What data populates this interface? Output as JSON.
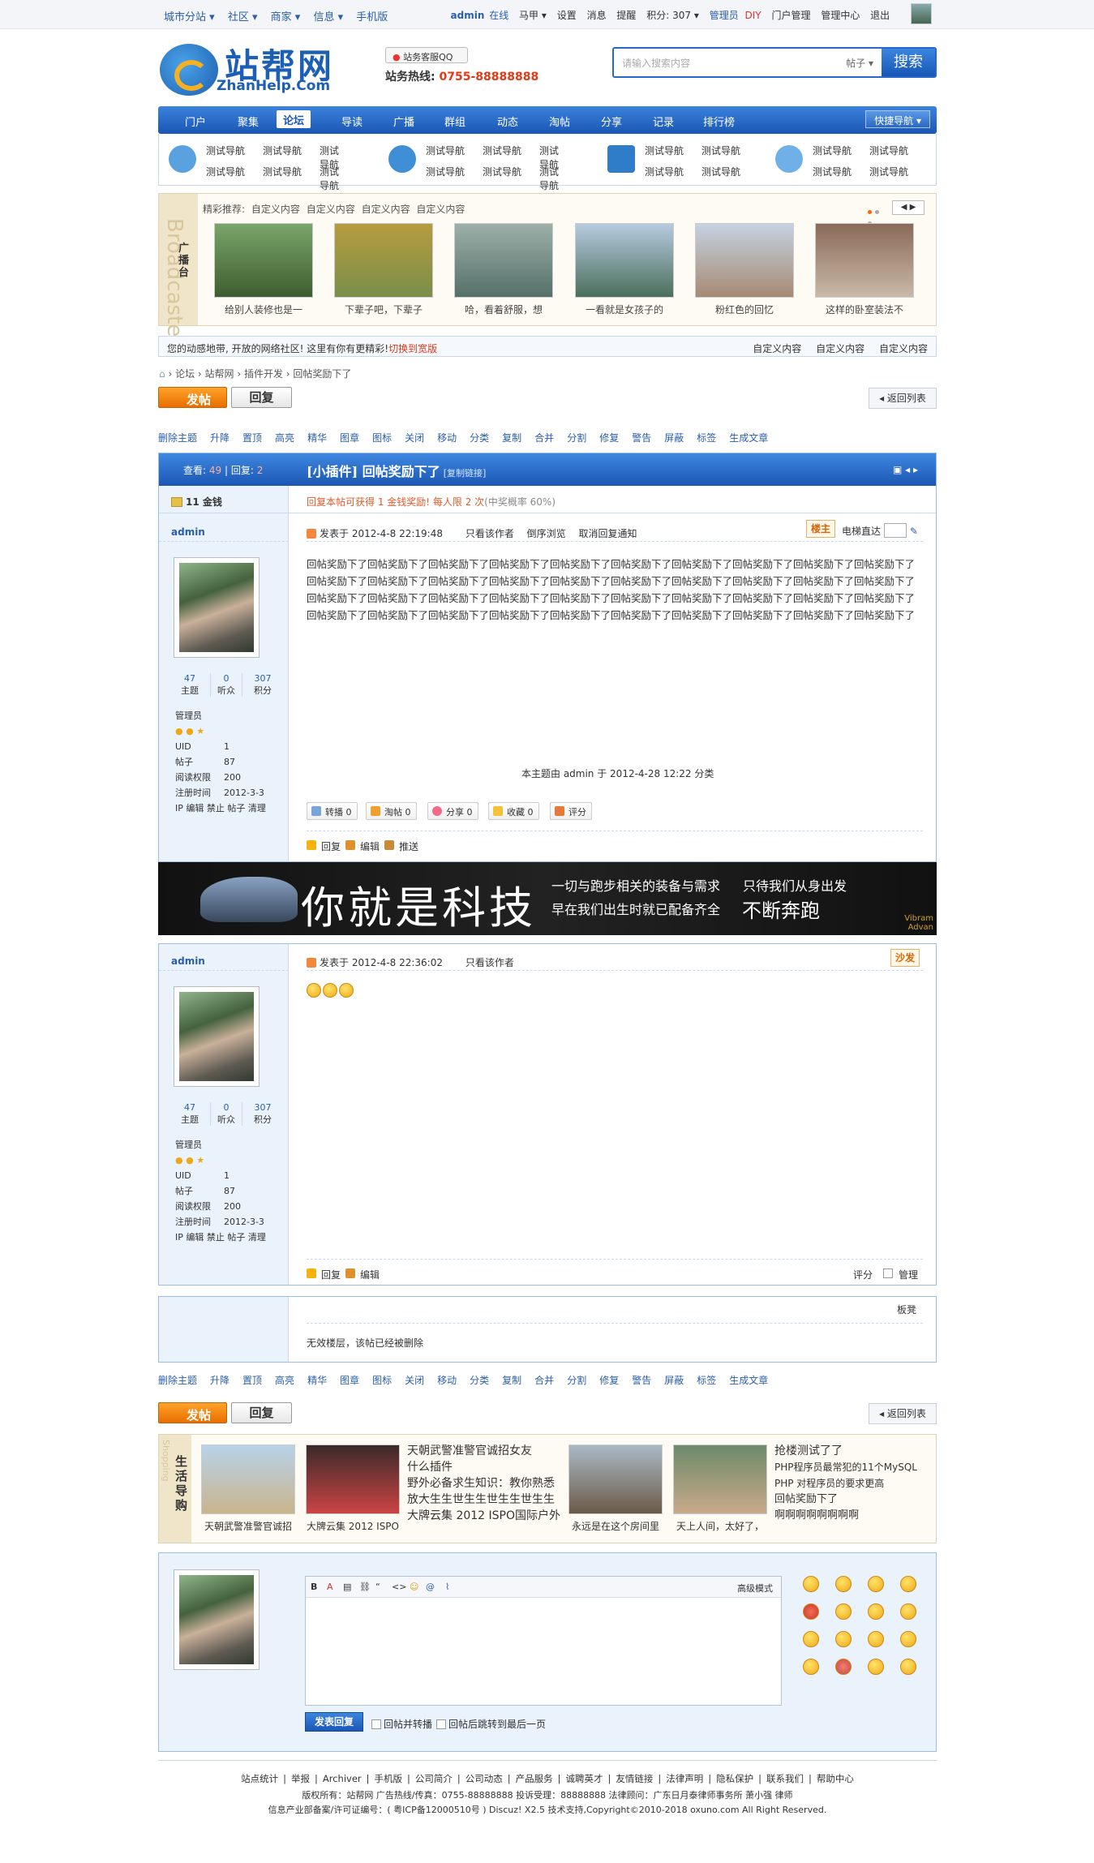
{
  "topbar": {
    "left": [
      "城市分站 ▾",
      "社区 ▾",
      "商家 ▾",
      "信息 ▾",
      "手机版"
    ],
    "user": "admin",
    "online": "在线",
    "group": "马甲 ▾",
    "links": [
      "设置",
      "消息",
      "提醒",
      "积分: 307 ▾"
    ],
    "admin": "管理员",
    "diy": "DIY",
    "links2": [
      "门户管理",
      "管理中心",
      "退出"
    ]
  },
  "header": {
    "logo_cn": "站帮网",
    "logo_en": "ZhanHelp.Com",
    "qq": "站务客服QQ",
    "hotline_label": "站务热线:",
    "hotline": "0755-88888888",
    "search_placeholder": "请输入搜索内容",
    "search_type": "帖子 ▾",
    "search_btn": "搜索"
  },
  "nav": {
    "items": [
      "门户",
      "聚集",
      "论坛",
      "导读",
      "广播",
      "群组",
      "动态",
      "淘帖",
      "分享",
      "记录",
      "排行榜"
    ],
    "quick": "快捷导航 ▾"
  },
  "subnav": {
    "link": "测试导航"
  },
  "showcase": {
    "side_label": "广播台",
    "side_en": "Broadcaster",
    "head": "精彩推荐:",
    "customs": [
      "自定义内容",
      "自定义内容",
      "自定义内容",
      "自定义内容"
    ],
    "arrows": "◀ ▶",
    "captions": [
      "给别人装修也是一",
      "下辈子吧，下辈子",
      "哈，看着舒服，想",
      "一看就是女孩子的",
      "粉红色的回忆",
      "这样的卧室装法不"
    ]
  },
  "notice": {
    "text": "您的动感地带, 开放的网络社区! 这里有你有更精彩!",
    "link": "切换到宽版",
    "right": [
      "自定义内容",
      "自定义内容",
      "自定义内容"
    ]
  },
  "crumb": [
    "论坛",
    "站帮网",
    "插件开发",
    "回帖奖励下了"
  ],
  "actions": {
    "post": "发帖",
    "reply": "回复",
    "back": "返回列表"
  },
  "mod": [
    "删除主题",
    "升降",
    "置顶",
    "高亮",
    "精华",
    "图章",
    "图标",
    "关闭",
    "移动",
    "分类",
    "复制",
    "合并",
    "分割",
    "修复",
    "警告",
    "屏蔽",
    "标签",
    "生成文章"
  ],
  "thread": {
    "view_label": "查看:",
    "views": "49",
    "reply_label": "回复:",
    "replies": "2",
    "title": "[小插件] 回帖奖励下了",
    "copy": "[复制链接]",
    "reward_gold": "11 金钱",
    "reward_text": "回复本帖可获得 1 金钱奖励! 每人限 2 次",
    "reward_rate": "(中奖概率 60%)"
  },
  "post1": {
    "author": "admin",
    "time": "发表于 2012-4-8 22:19:48",
    "opts": [
      "只看该作者",
      "倒序浏览",
      "取消回复通知"
    ],
    "floor": "楼主",
    "jump": "电梯直达",
    "body": "回帖奖励下了回帖奖励下了回帖奖励下了回帖奖励下了回帖奖励下了回帖奖励下了回帖奖励下了回帖奖励下了回帖奖励下了回帖奖励下了回帖奖励下了回帖奖励下了回帖奖励下了回帖奖励下了回帖奖励下了回帖奖励下了回帖奖励下了回帖奖励下了回帖奖励下了回帖奖励下了回帖奖励下了回帖奖励下了回帖奖励下了回帖奖励下了回帖奖励下了回帖奖励下了回帖奖励下了回帖奖励下了回帖奖励下了回帖奖励下了回帖奖励下了回帖奖励下了回帖奖励下了回帖奖励下了回帖奖励下了回帖奖励下了回帖奖励下了回帖奖励下了回帖奖励下了回帖奖励下了",
    "classify": "本主题由 admin 于 2012-4-28 12:22 分类",
    "shares": [
      "转播 0",
      "淘帖 0",
      "分享 0",
      "收藏 0",
      "评分"
    ],
    "foot": [
      "回复",
      "编辑",
      "推送"
    ]
  },
  "user": {
    "stats": [
      {
        "n": "47",
        "l": "主题"
      },
      {
        "n": "0",
        "l": "听众"
      },
      {
        "n": "307",
        "l": "积分"
      }
    ],
    "group": "管理员",
    "uid_l": "UID",
    "uid": "1",
    "posts_l": "帖子",
    "posts": "87",
    "perm_l": "阅读权限",
    "perm": "200",
    "reg_l": "注册时间",
    "reg": "2012-3-3",
    "tools": "IP 编辑 禁止 帖子 清理"
  },
  "banner": {
    "big": "你就是科技",
    "s1": "一切与跑步相关的装备与需求",
    "s2": "早在我们出生时就已配备齐全",
    "s3": "只待我们从身出发",
    "s4": "不断奔跑",
    "brand": "Vibram Advan"
  },
  "post2": {
    "author": "admin",
    "time": "发表于 2012-4-8 22:36:02",
    "opt": "只看该作者",
    "floor": "沙发",
    "foot": [
      "回复",
      "编辑"
    ],
    "rate": "评分",
    "manage": "管理"
  },
  "post3": {
    "floor": "板凳",
    "text": "无效楼层，该帖已经被删除"
  },
  "shop": {
    "side": "生活导购",
    "side_en": "Shopping",
    "captions": [
      "天朝武警准警官诚招",
      "大牌云集 2012 ISPO",
      "",
      "",
      "永远是在这个房间里",
      "天上人间，太好了，"
    ],
    "t1": [
      "天朝武警准警官诚招女友",
      "什么插件",
      "野外必备求生知识：教你熟悉",
      "放大生生世生生世生生世生生",
      "大牌云集 2012 ISPO国际户外"
    ],
    "t2": [
      "抢楼测试了了",
      "PHP程序员最常犯的11个MySQL",
      "PHP 对程序员的要求更高",
      "回帖奖励下了",
      "啊啊啊啊啊啊啊啊"
    ]
  },
  "replybox": {
    "advanced": "高级模式",
    "submit": "发表回复",
    "chk1": "回帖并转播",
    "chk2": "回帖后跳转到最后一页"
  },
  "footer": {
    "l1": [
      "站点统计",
      "举报",
      "Archiver",
      "手机版",
      "公司简介",
      "公司动态",
      "产品服务",
      "诚聘英才",
      "友情链接",
      "法律声明",
      "隐私保护",
      "联系我们",
      "帮助中心"
    ],
    "l2": "版权所有：站帮网  广告热线/传真：0755-88888888  投诉受理：88888888 法律顾问：广东日月泰律师事务所 萧小强 律师",
    "l3": "信息产业部备案/许可证编号：( 粤ICP备12000510号 )  Discuz! X2.5 技术支持,Copyright©2010-2018 oxuno.com All Right Reserved."
  }
}
